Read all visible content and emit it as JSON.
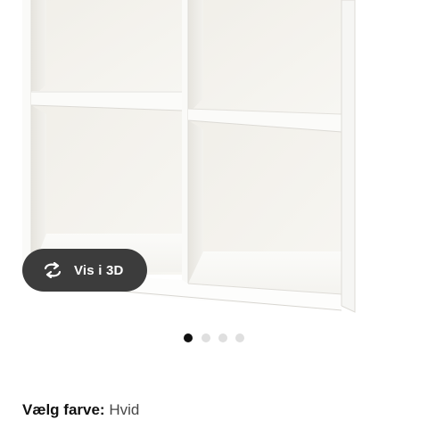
{
  "view_3d": {
    "label": "Vis i 3D",
    "icon": "rotate-3d-icon"
  },
  "carousel": {
    "count": 4,
    "active_index": 0
  },
  "color_selector": {
    "label": "Vælg farve:",
    "value": "Hvid"
  },
  "colors": {
    "button_bg": "#3c3c3c",
    "dot_active": "#111111",
    "dot_inactive": "#dfdfdf",
    "text": "#111111"
  }
}
